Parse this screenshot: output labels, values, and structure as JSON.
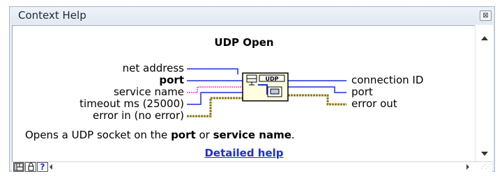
{
  "window": {
    "title": "Context Help",
    "close_glyph": "⊠"
  },
  "help": {
    "vi_name": "UDP Open",
    "inputs": [
      "net address",
      "port",
      "service name",
      "timeout ms (25000)",
      "error in (no error)"
    ],
    "outputs": [
      "connection ID",
      "port",
      "error out"
    ],
    "icon_label": "UDP",
    "description_parts": [
      "Opens a UDP socket on the ",
      "port",
      " or ",
      "service name",
      "."
    ],
    "link_text": "Detailed help"
  },
  "toolbar": {
    "buttons": [
      "show-optional-terminals",
      "lock-help",
      "detailed-help"
    ],
    "help_glyph": "?"
  },
  "colors": {
    "wire_numeric": "#1a2fd6",
    "wire_string": "#ff33cc",
    "wire_cluster": "#8a7a10",
    "link": "#1a2fd6"
  },
  "icons": {
    "close": "close-icon",
    "scroll_up": "scroll-up-arrow-icon",
    "scroll_down": "scroll-down-arrow-icon",
    "scroll_left": "scroll-left-arrow-icon",
    "scroll_right": "scroll-right-arrow-icon",
    "vi_icon": "udp-open-vi-icon"
  }
}
